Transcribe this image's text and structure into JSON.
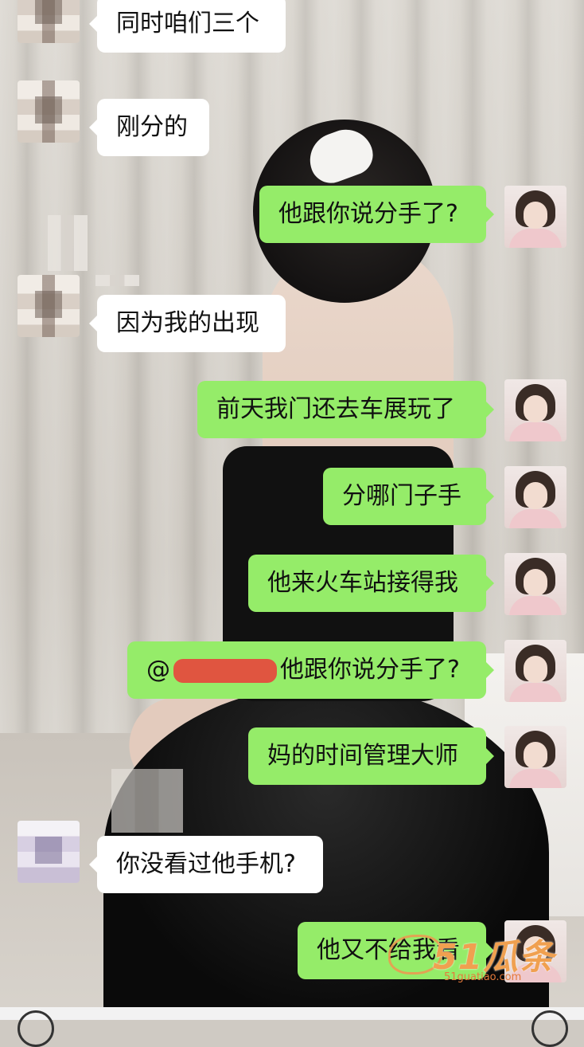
{
  "messages": [
    {
      "side": "left",
      "text": "同时咱们三个"
    },
    {
      "side": "left",
      "text": "刚分的"
    },
    {
      "side": "right",
      "text": "他跟你说分手了?"
    },
    {
      "side": "left",
      "text": "因为我的出现"
    },
    {
      "side": "right",
      "text": "前天我门还去车展玩了"
    },
    {
      "side": "right",
      "text": "分哪门子手"
    },
    {
      "side": "right",
      "text": "他来火车站接得我"
    },
    {
      "side": "right",
      "prefix": "@",
      "text": "他跟你说分手了?"
    },
    {
      "side": "right",
      "text": "妈的时间管理大师"
    },
    {
      "side": "left",
      "text": "你没看过他手机?"
    },
    {
      "side": "right",
      "text": "他又不给我看"
    }
  ],
  "watermark": {
    "brand": "51瓜条",
    "url": "51guatiao.com"
  },
  "colors": {
    "own_bubble": "#95ec69",
    "other_bubble": "#ffffff",
    "redaction": "#e8453c"
  }
}
